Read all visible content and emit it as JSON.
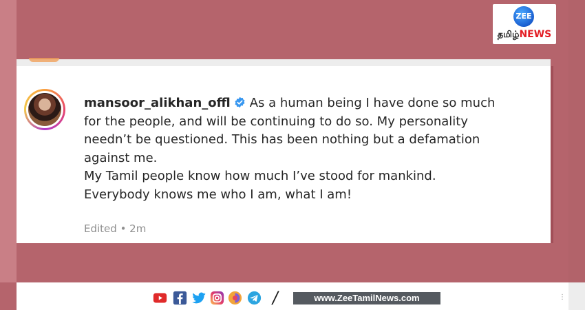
{
  "post": {
    "username": "mansoor_alikhan_offl",
    "caption_lines": [
      "As a human being I have done so much",
      "for the people, and will be continuing to do so. My personality",
      "needn’t be questioned. This has been nothing but a defamation",
      "against me.",
      "My Tamil people know how much I’ve stood for mankind.",
      "Everybody knows me who I am, what I am!"
    ],
    "meta": "Edited • 2m"
  },
  "footer": {
    "social_icons": [
      "youtube-icon",
      "facebook-icon",
      "twitter-icon",
      "instagram-icon",
      "sharechat-icon",
      "telegram-icon"
    ],
    "slash": "/",
    "url": "www.ZeeTamilNews.com"
  },
  "logo": {
    "zee": "ZEE",
    "tamil": "தமிழ்",
    "news": "NEWS"
  },
  "colors": {
    "background": "#b5646c",
    "verified": "#3897f0",
    "youtube": "#e02a2a",
    "facebook": "#3b5998",
    "twitter": "#1da1f2",
    "instagram": "#d6249f",
    "telegram": "#2ca5e0",
    "news_red": "#e31e25"
  }
}
